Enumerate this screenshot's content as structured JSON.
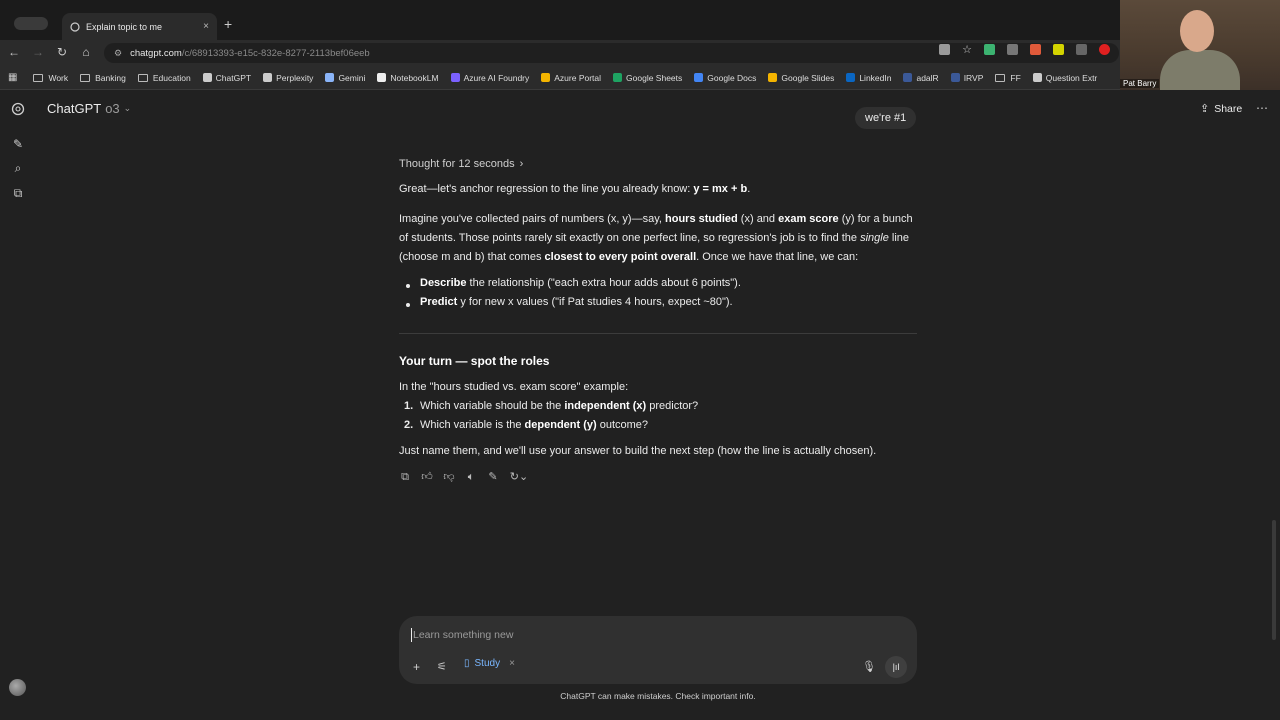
{
  "browser": {
    "tab_title": "Explain topic to me",
    "tab_close": "×",
    "new_tab": "+",
    "url_host": "chatgpt.com",
    "url_path": "/c/68913393-e15c-832e-8277-2113bef06eeb",
    "bookmarks": [
      {
        "label": "Work",
        "icon": "folder-icon",
        "color": "#bbbbbb"
      },
      {
        "label": "Banking",
        "icon": "folder-icon",
        "color": "#bbbbbb"
      },
      {
        "label": "Education",
        "icon": "folder-icon",
        "color": "#bbbbbb"
      },
      {
        "label": "ChatGPT",
        "icon": "openai-icon",
        "color": "#cccccc"
      },
      {
        "label": "Perplexity",
        "icon": "perplexity-icon",
        "color": "#cccccc"
      },
      {
        "label": "Gemini",
        "icon": "gemini-icon",
        "color": "#8ab4f8"
      },
      {
        "label": "NotebookLM",
        "icon": "notebooklm-icon",
        "color": "#eeeeee"
      },
      {
        "label": "Azure AI Foundry",
        "icon": "azure-ai-icon",
        "color": "#7b61ff"
      },
      {
        "label": "Azure Portal",
        "icon": "azure-portal-icon",
        "color": "#f3b400"
      },
      {
        "label": "Google Sheets",
        "icon": "sheets-icon",
        "color": "#1ea362"
      },
      {
        "label": "Google Docs",
        "icon": "docs-icon",
        "color": "#4285f4"
      },
      {
        "label": "Google Slides",
        "icon": "slides-icon",
        "color": "#f4b400"
      },
      {
        "label": "LinkedIn",
        "icon": "linkedin-icon",
        "color": "#0a66c2"
      },
      {
        "label": "adalR",
        "icon": "adalr-icon",
        "color": "#3b5998"
      },
      {
        "label": "IRVP",
        "icon": "irvp-icon",
        "color": "#3b5998"
      },
      {
        "label": "FF",
        "icon": "folder-icon",
        "color": "#bbbbbb"
      },
      {
        "label": "Question Extr",
        "icon": "question-icon",
        "color": "#cccccc"
      }
    ],
    "webcam_name": "Pat Barry"
  },
  "header": {
    "model_name": "ChatGPT",
    "model_version": "o3",
    "share_label": "Share"
  },
  "conversation": {
    "user_message": "we're #1",
    "thought_label": "Thought for 12 seconds",
    "intro_1": "Great—let's anchor regression to the line you already know: ",
    "intro_eq": "y = mx + b",
    "intro_end": ".",
    "para2_a": "Imagine you've collected pairs of numbers (x, y)—say, ",
    "para2_b": "hours studied",
    "para2_c": " (x) and ",
    "para2_d": "exam score",
    "para2_e": " (y) for a bunch of students. Those points rarely sit exactly on one perfect line, so regression's job is to find the ",
    "para2_f": "single",
    "para2_g": " line (choose m and b) that comes ",
    "para2_h": "closest to every point overall",
    "para2_i": ". Once we have that line, we can:",
    "bullets": [
      {
        "bold": "Describe",
        "text": " the relationship (\"each extra hour adds about 6 points\")."
      },
      {
        "bold": "Predict",
        "text": " y for new x values (\"if Pat studies 4 hours, expect ~80\")."
      }
    ],
    "section_title": "Your turn — spot the roles",
    "section_intro": "In the \"hours studied vs. exam score\" example:",
    "questions": [
      {
        "num": "1.",
        "a": "Which variable should be the ",
        "bold": "independent (x)",
        "b": " predictor?"
      },
      {
        "num": "2.",
        "a": "Which variable is the ",
        "bold": "dependent (y)",
        "b": " outcome?"
      }
    ],
    "closing": "Just name them, and we'll use your answer to build the next step (how the line is actually chosen)."
  },
  "composer": {
    "placeholder": "Learn something new",
    "study_label": "Study",
    "study_remove": "×"
  },
  "footer": {
    "disclaimer": "ChatGPT can make mistakes. Check important info."
  }
}
